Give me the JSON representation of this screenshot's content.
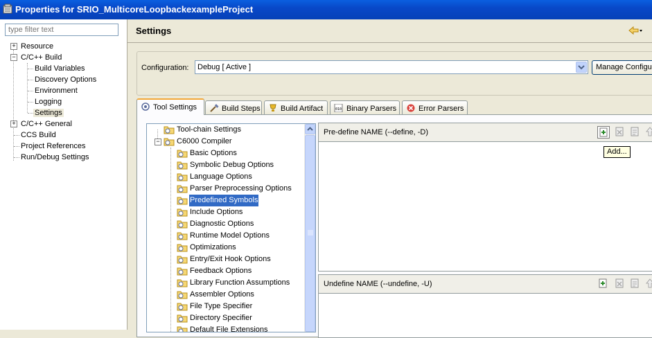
{
  "window": {
    "title": "Properties for SRIO_MulticoreLoopbackexampleProject"
  },
  "filter": {
    "placeholder": "type filter text"
  },
  "nav": {
    "items": [
      {
        "label": "Resource"
      },
      {
        "label": "C/C++ Build"
      },
      {
        "label": "Build Variables"
      },
      {
        "label": "Discovery Options"
      },
      {
        "label": "Environment"
      },
      {
        "label": "Logging"
      },
      {
        "label": "Settings"
      },
      {
        "label": "C/C++ General"
      },
      {
        "label": "CCS Build"
      },
      {
        "label": "Project References"
      },
      {
        "label": "Run/Debug Settings"
      }
    ]
  },
  "page": {
    "title": "Settings"
  },
  "configuration": {
    "label": "Configuration:",
    "value": "Debug  [ Active ]",
    "manage_label": "Manage Configurations..."
  },
  "tabs": [
    {
      "label": "Tool Settings"
    },
    {
      "label": "Build Steps"
    },
    {
      "label": "Build Artifact"
    },
    {
      "label": "Binary Parsers"
    },
    {
      "label": "Error Parsers"
    }
  ],
  "tool_tree": {
    "items": [
      {
        "label": "Tool-chain Settings"
      },
      {
        "label": "C6000 Compiler"
      },
      {
        "label": "Basic Options"
      },
      {
        "label": "Symbolic Debug Options"
      },
      {
        "label": "Language Options"
      },
      {
        "label": "Parser Preprocessing Options"
      },
      {
        "label": "Predefined Symbols"
      },
      {
        "label": "Include Options"
      },
      {
        "label": "Diagnostic Options"
      },
      {
        "label": "Runtime Model Options"
      },
      {
        "label": "Optimizations"
      },
      {
        "label": "Entry/Exit Hook Options"
      },
      {
        "label": "Feedback Options"
      },
      {
        "label": "Library Function Assumptions"
      },
      {
        "label": "Assembler Options"
      },
      {
        "label": "File Type Specifier"
      },
      {
        "label": "Directory Specifier"
      },
      {
        "label": "Default File Extensions"
      }
    ]
  },
  "predefine": {
    "title": "Pre-define NAME (--define, -D)"
  },
  "undefine": {
    "title": "Undefine NAME (--undefine, -U)"
  },
  "tooltip": {
    "text": "Add..."
  },
  "colors": {
    "titlebar": "#0a5fe0",
    "selection": "#316ac5",
    "active_tab_accent": "#f3a737"
  }
}
